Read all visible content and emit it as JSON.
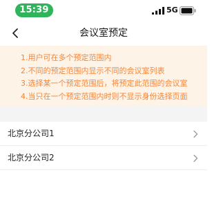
{
  "status_bar": {
    "time": "15:39",
    "network": "5G",
    "time_bg_color": "#2fb35b"
  },
  "nav": {
    "title": "会议室预定",
    "back_icon": "chevron-left-icon"
  },
  "notice": {
    "text_color": "#f5853a",
    "bg_color": "#fdf4e7",
    "lines": [
      "1.用户可在多个预定范围内",
      "2.不同的预定范围内显示不同的会议室列表",
      "3.选择某一个预定范围后，将预定此范围的会议室",
      "4.当只在一个预定范围内时则不显示身份选择页面"
    ]
  },
  "list": {
    "items": [
      {
        "label": "北京分公司1",
        "icon": "chevron-right-icon"
      },
      {
        "label": "北京分公司2",
        "icon": "chevron-right-icon"
      }
    ]
  }
}
